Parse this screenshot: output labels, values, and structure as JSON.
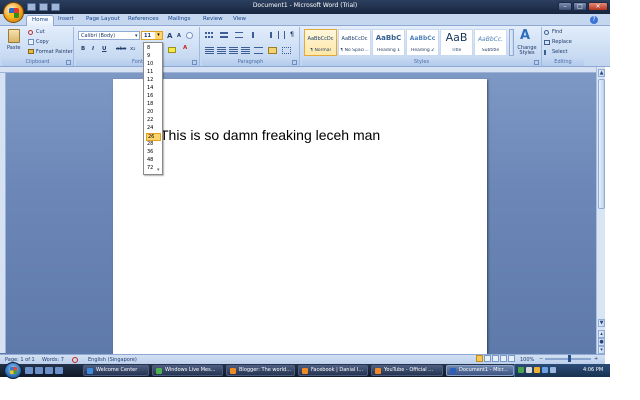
{
  "window": {
    "title": "Document1 - Microsoft Word (Trial)",
    "controls": {
      "minimize": "–",
      "maximize": "□",
      "close": "✕"
    }
  },
  "tabs": [
    {
      "label": "Home",
      "active": true
    },
    {
      "label": "Insert"
    },
    {
      "label": "Page Layout"
    },
    {
      "label": "References"
    },
    {
      "label": "Mailings"
    },
    {
      "label": "Review"
    },
    {
      "label": "View"
    }
  ],
  "ribbon": {
    "clipboard": {
      "label": "Clipboard",
      "paste": "Paste",
      "cut": "Cut",
      "copy": "Copy",
      "format_painter": "Format Painter"
    },
    "font": {
      "label": "Font",
      "font_name": "Calibri (Body)",
      "font_size": "11",
      "bold": "B",
      "italic": "I",
      "underline": "U",
      "strike": "abe",
      "subscript": "x₂",
      "grow": "A",
      "shrink": "A"
    },
    "paragraph": {
      "label": "Paragraph"
    },
    "styles": {
      "label": "Styles",
      "tiles": [
        {
          "preview": "AaBbCcDc",
          "name": "¶ Normal",
          "selected": true
        },
        {
          "preview": "AaBbCcDc",
          "name": "¶ No Spaci..."
        },
        {
          "preview": "AaBbC",
          "name": "Heading 1"
        },
        {
          "preview": "AaBbCc",
          "name": "Heading 2"
        },
        {
          "preview": "AaB",
          "name": "Title"
        },
        {
          "preview": "AaBbCc.",
          "name": "Subtitle"
        }
      ],
      "change_styles": "Change Styles"
    },
    "editing": {
      "label": "Editing",
      "find": "Find",
      "replace": "Replace",
      "select": "Select"
    }
  },
  "font_size_dropdown": {
    "options": [
      "8",
      "9",
      "10",
      "11",
      "12",
      "14",
      "16",
      "18",
      "20",
      "22",
      "24",
      "26",
      "28",
      "36",
      "48",
      "72"
    ],
    "highlighted": "26"
  },
  "document": {
    "text": "This is so damn freaking leceh man"
  },
  "statusbar": {
    "page": "Page: 1 of 1",
    "words": "Words: 7",
    "language": "English (Singapore)",
    "zoom": "100%"
  },
  "taskbar": {
    "tasks": [
      {
        "label": "Welcome Center",
        "color": "#3d8be0"
      },
      {
        "label": "Windows Live Mes...",
        "color": "#4fb04f"
      },
      {
        "label": "Blogger: The world...",
        "color": "#f08a24"
      },
      {
        "label": "Facebook | Danial I...",
        "color": "#f08a24"
      },
      {
        "label": "YouTube - Official ...",
        "color": "#f08a24"
      },
      {
        "label": "Document1 - Micr...",
        "color": "#2b5fb8",
        "active": true
      }
    ],
    "clock": "4:06 PM"
  }
}
